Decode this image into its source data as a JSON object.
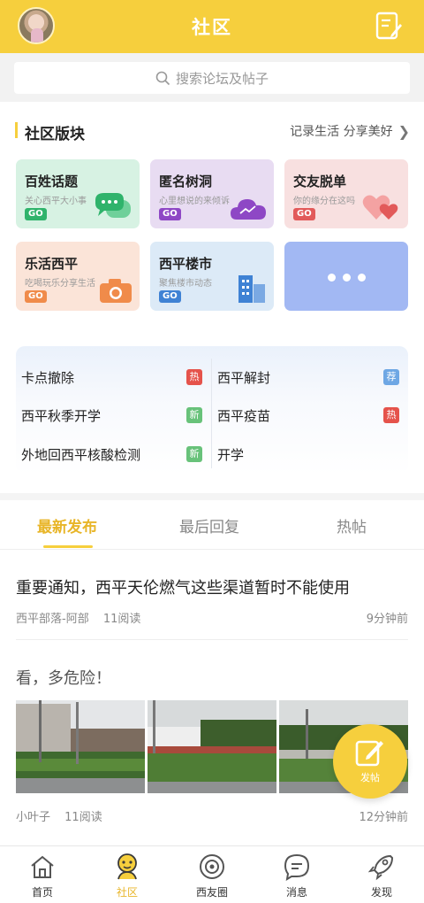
{
  "header": {
    "title": "社区"
  },
  "search": {
    "placeholder": "搜索论坛及帖子"
  },
  "section": {
    "title": "社区版块",
    "more": "记录生活 分享美好"
  },
  "boards": [
    {
      "title": "百姓话题",
      "subtitle": "关心西平大小事",
      "go": "GO",
      "accent": "#2fb36b",
      "icon": "chat-bubbles-icon"
    },
    {
      "title": "匿名树洞",
      "subtitle": "心里想说的来倾诉",
      "go": "GO",
      "accent": "#8e47c5",
      "icon": "cloud-icon"
    },
    {
      "title": "交友脱单",
      "subtitle": "你的缘分在这吗",
      "go": "GO",
      "accent": "#e25a5a",
      "icon": "hearts-icon"
    },
    {
      "title": "乐活西平",
      "subtitle": "吃喝玩乐分享生活",
      "go": "GO",
      "accent": "#f08b4a",
      "icon": "camera-icon"
    },
    {
      "title": "西平楼市",
      "subtitle": "聚焦楼市动态",
      "go": "GO",
      "accent": "#3f82d4",
      "icon": "buildings-icon"
    },
    {
      "title": "",
      "icon": "more-dots-icon",
      "accent": "#a2b8f3"
    }
  ],
  "topics": [
    {
      "label": "卡点撤除",
      "tag": "热"
    },
    {
      "label": "西平解封",
      "tag": "荐"
    },
    {
      "label": "西平秋季开学",
      "tag": "新"
    },
    {
      "label": "西平疫苗",
      "tag": "热"
    },
    {
      "label": "外地回西平核酸检测",
      "tag": "新"
    },
    {
      "label": "开学",
      "tag": ""
    }
  ],
  "tabs": [
    "最新发布",
    "最后回复",
    "热帖"
  ],
  "posts": [
    {
      "title": "重要通知，西平天伦燃气这些渠道暂时不能使用",
      "author": "西平部落-阿部",
      "reads": "11阅读",
      "time": "9分钟前"
    },
    {
      "title": "看，多危险！",
      "author": "小叶子",
      "reads": "11阅读",
      "time": "12分钟前"
    }
  ],
  "fab": {
    "label": "发帖"
  },
  "nav": [
    {
      "label": "首页",
      "icon": "home-icon"
    },
    {
      "label": "社区",
      "icon": "community-icon"
    },
    {
      "label": "西友圈",
      "icon": "moments-icon"
    },
    {
      "label": "消息",
      "icon": "message-icon"
    },
    {
      "label": "发现",
      "icon": "rocket-icon"
    }
  ],
  "colors": {
    "brand": "#f6cf3d",
    "active": "#e8b528",
    "hot": "#e5534b",
    "new": "#68c27a",
    "recommend": "#6ea7e4"
  }
}
